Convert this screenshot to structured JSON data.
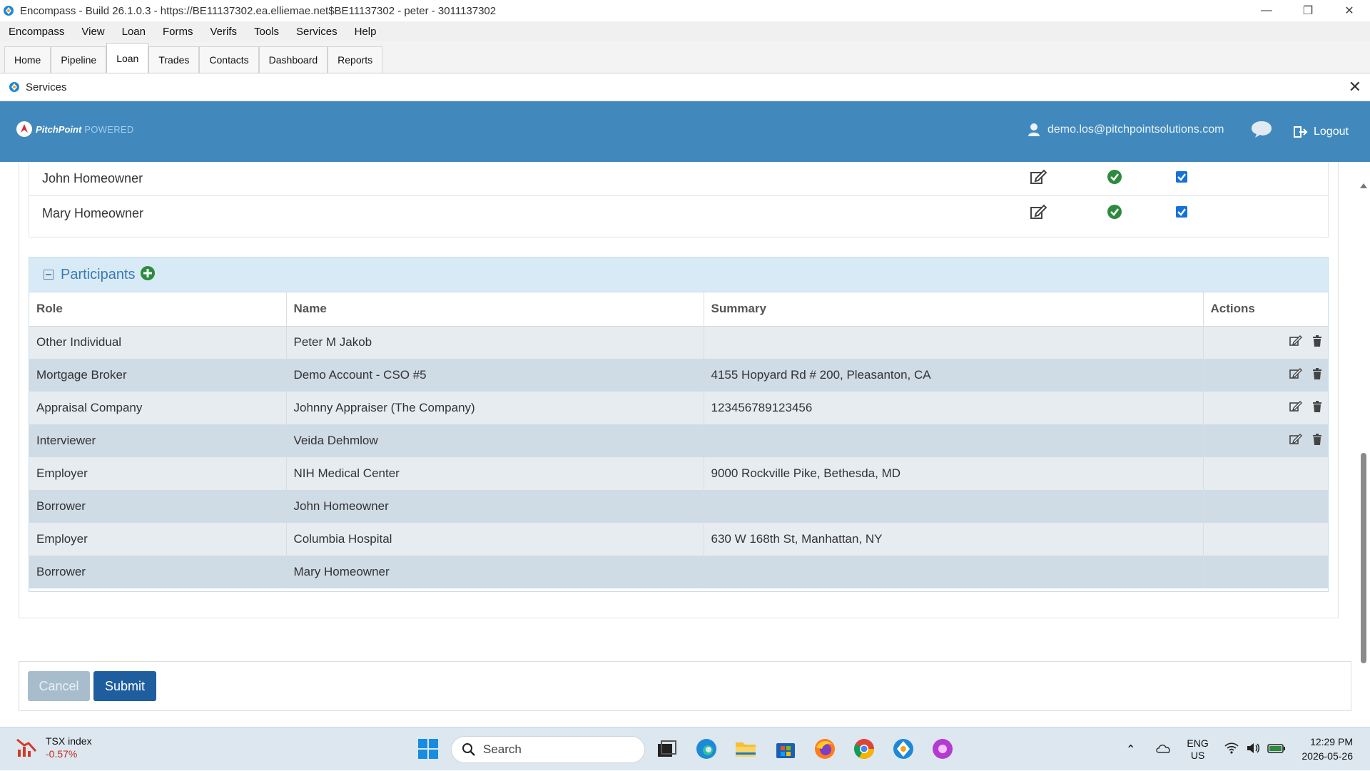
{
  "window": {
    "title": "Encompass - Build 26.1.0.3 - https://BE11137302.ea.elliemae.net$BE11137302 - peter - 3011137302"
  },
  "menu": [
    "Encompass",
    "View",
    "Loan",
    "Forms",
    "Verifs",
    "Tools",
    "Services",
    "Help"
  ],
  "tabs": [
    "Home",
    "Pipeline",
    "Loan",
    "Trades",
    "Contacts",
    "Dashboard",
    "Reports"
  ],
  "active_tab": "Loan",
  "services_bar": {
    "title": "Services"
  },
  "header": {
    "brand": "PitchPoint",
    "brand_suffix": "POWERED",
    "user_email": "demo.los@pitchpointsolutions.com",
    "logout_label": "Logout",
    "bg_color": "#4189bd"
  },
  "borrowers": [
    {
      "name": "John Homeowner"
    },
    {
      "name": "Mary Homeowner"
    }
  ],
  "participants": {
    "title": "Participants",
    "columns": [
      "Role",
      "Name",
      "Summary",
      "Actions"
    ],
    "rows": [
      {
        "role": "Other Individual",
        "name": "Peter M Jakob",
        "summary": "",
        "actions": true
      },
      {
        "role": "Mortgage Broker",
        "name": "Demo Account - CSO #5",
        "summary": "4155 Hopyard Rd # 200, Pleasanton, CA",
        "actions": true
      },
      {
        "role": "Appraisal Company",
        "name": "Johnny Appraiser (The Company)",
        "summary": "123456789123456",
        "actions": true
      },
      {
        "role": "Interviewer",
        "name": "Veida Dehmlow",
        "summary": "",
        "actions": true
      },
      {
        "role": "Employer",
        "name": "NIH Medical Center",
        "summary": "9000 Rockville Pike, Bethesda, MD",
        "actions": false
      },
      {
        "role": "Borrower",
        "name": "John Homeowner",
        "summary": "",
        "actions": false
      },
      {
        "role": "Employer",
        "name": "Columbia Hospital",
        "summary": "630 W 168th St, Manhattan, NY",
        "actions": false
      },
      {
        "role": "Borrower",
        "name": "Mary Homeowner",
        "summary": "",
        "actions": false
      }
    ]
  },
  "footer": {
    "cancel_label": "Cancel",
    "submit_label": "Submit"
  },
  "taskbar": {
    "widget_name": "TSX index",
    "widget_change": "-0.57%",
    "search_placeholder": "Search",
    "lang_top": "ENG",
    "lang_bottom": "US",
    "time": "12:29 PM",
    "date": "2026-05-26"
  }
}
